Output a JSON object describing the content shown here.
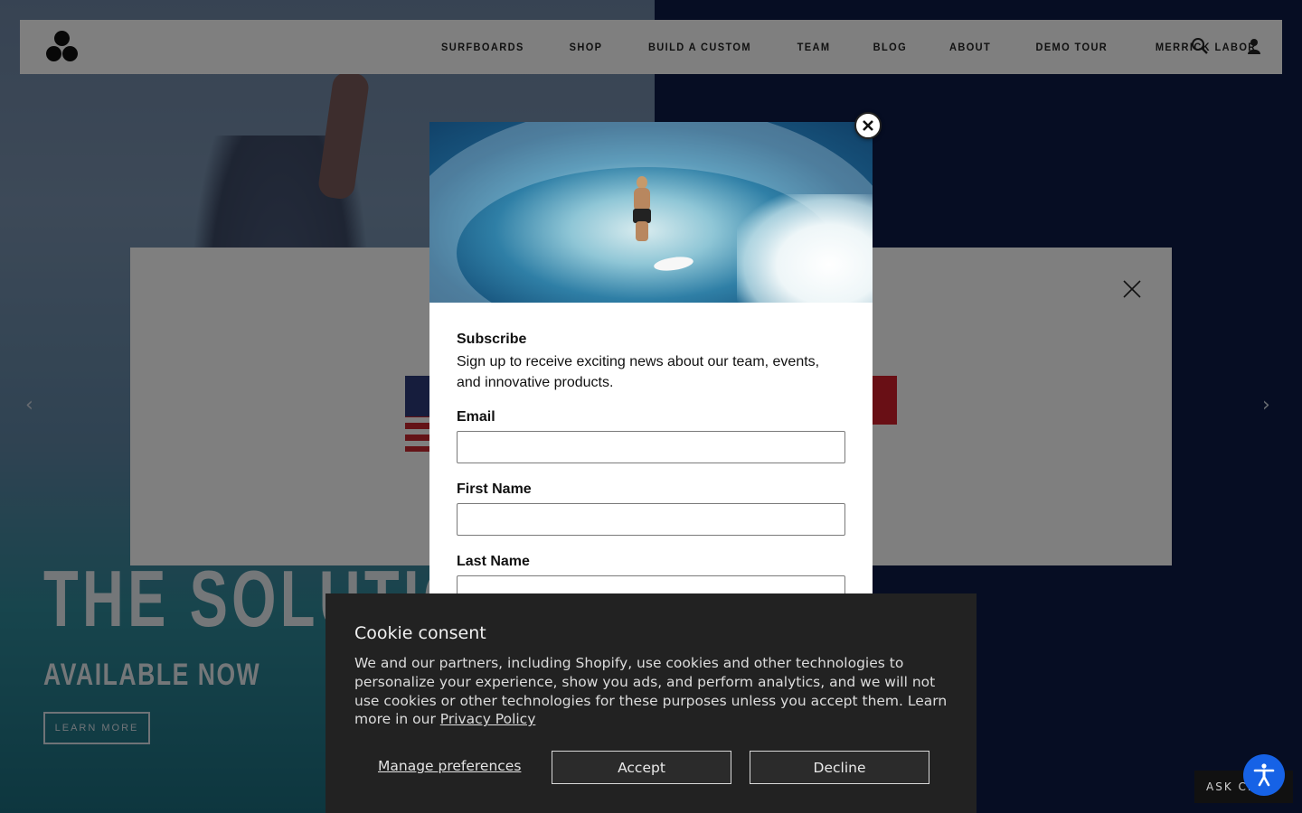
{
  "header": {
    "nav": [
      "SURFBOARDS",
      "SHOP",
      "BUILD A CUSTOM",
      "TEAM",
      "BLOG",
      "ABOUT",
      "DEMO TOUR",
      "MERRICK LABOR"
    ],
    "search_icon": "search-icon",
    "account_icon": "user-icon"
  },
  "hero": {
    "headline": "THE SOLUTION",
    "subheadline": "AVAILABLE NOW",
    "cta": "LEARN MORE"
  },
  "subscribe_modal": {
    "heading": "Subscribe",
    "intro": "Sign up to receive exciting news about our team, events, and innovative products.",
    "fields": {
      "email_label": "Email",
      "first_name_label": "First Name",
      "last_name_label": "Last Name"
    },
    "close_icon": "close-icon"
  },
  "cookie_banner": {
    "title": "Cookie consent",
    "text": "We and our partners, including Shopify, use cookies and other technologies to personalize your experience, show you ads, and perform analytics, and we will not use cookies or other technologies for these purposes unless you accept them. Learn more in our ",
    "policy_link": "Privacy Policy",
    "manage_label": "Manage preferences",
    "accept_label": "Accept",
    "decline_label": "Decline"
  },
  "chat_widget": {
    "label": "ASK CI"
  },
  "colors": {
    "accessibility_blue": "#1662e6",
    "cookie_bg": "#222222",
    "region_red": "#d21f2b"
  }
}
